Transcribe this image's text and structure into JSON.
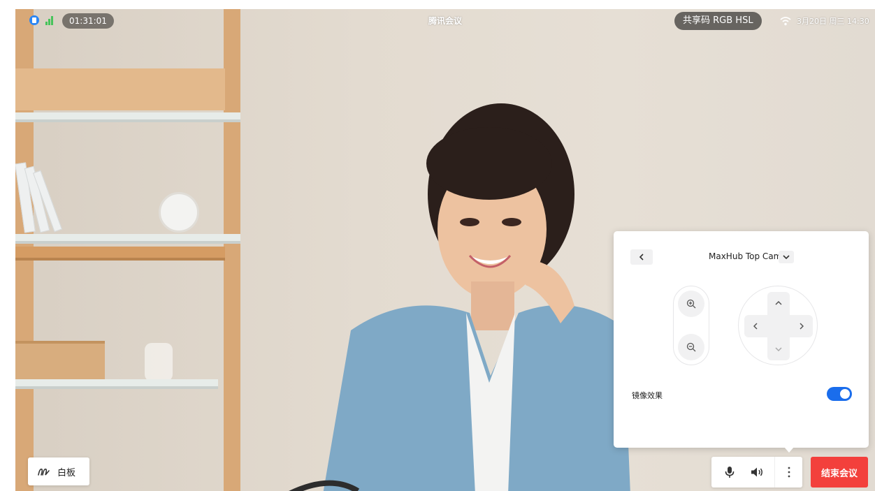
{
  "topbar": {
    "timer": "01:31:01",
    "app_title": "腾讯会议",
    "share_code": "共享码 RGB HSL",
    "datetime": "3月20日 周三 14:30",
    "icons": [
      "network-status-icon",
      "signal-bars-icon",
      "wifi-icon"
    ]
  },
  "camera_panel": {
    "camera_name": "MaxHub Top Cam",
    "mirror_label": "镜像效果",
    "mirror_enabled": true,
    "icons": [
      "back-chevron-icon",
      "dropdown-chevron-icon",
      "zoom-in-icon",
      "zoom-out-icon",
      "pan-up-icon",
      "pan-down-icon",
      "pan-left-icon",
      "pan-right-icon"
    ]
  },
  "bottom": {
    "whiteboard_label": "白板",
    "end_meeting_label": "结束会议",
    "icons": [
      "whiteboard-pen-icon",
      "microphone-icon",
      "speaker-icon",
      "more-vertical-icon"
    ]
  },
  "colors": {
    "accent": "#1a6dec",
    "danger": "#f3403c",
    "signal": "#48c35b",
    "network": "#2a86f5"
  }
}
